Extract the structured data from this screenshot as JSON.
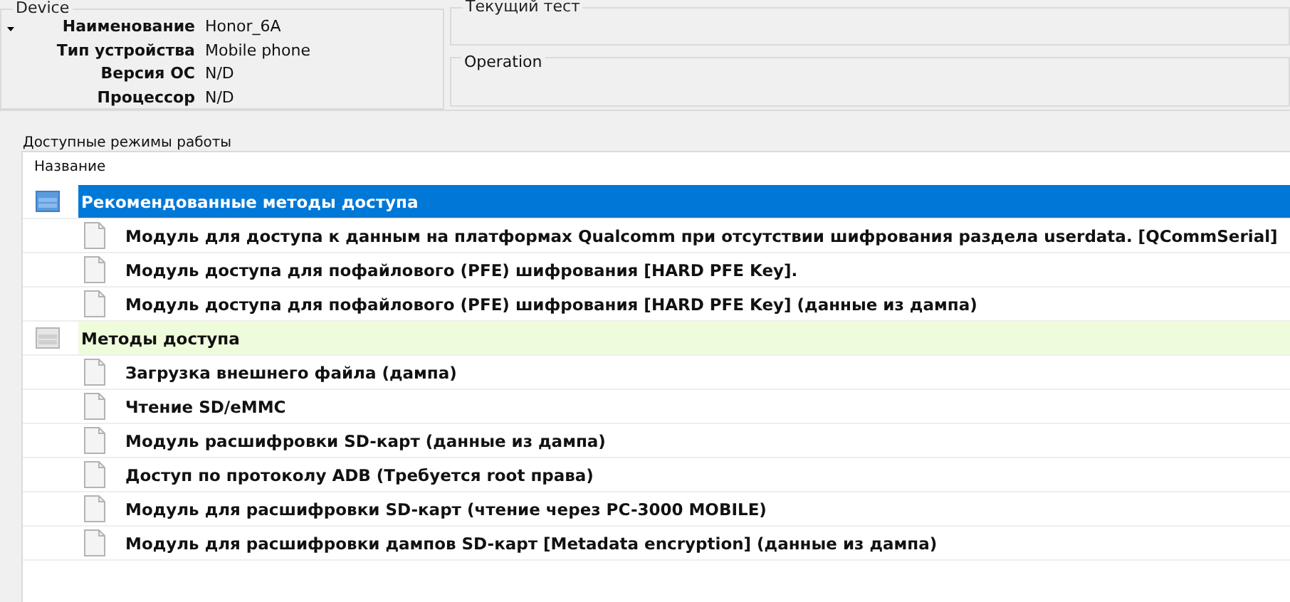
{
  "device": {
    "title": "Device",
    "fields": [
      {
        "label": "Наименование",
        "value": "Honor_6A"
      },
      {
        "label": "Тип устройства",
        "value": "Mobile phone"
      },
      {
        "label": "Версия ОС",
        "value": "N/D"
      },
      {
        "label": "Процессор",
        "value": "N/D"
      }
    ]
  },
  "current_test": {
    "title": "Текущий тест"
  },
  "operation": {
    "title": "Operation"
  },
  "modes": {
    "label": "Доступные режимы работы",
    "column": "Название",
    "groups": [
      {
        "title": "Рекомендованные методы доступа",
        "selected": true,
        "items": [
          "Модуль для доступа к данным на платформах Qualcomm при отсутствии шифрования раздела userdata. [QCommSerial]",
          "Модуль доступа для пофайлового (PFE) шифрования [HARD PFE Key].",
          "Модуль доступа для пофайлового (PFE) шифрования [HARD PFE Key] (данные из дампа)"
        ]
      },
      {
        "title": "Методы доступа",
        "selected": false,
        "items": [
          "Загрузка внешнего файла (дампа)",
          "Чтение SD/eMMC",
          "Модуль расшифровки SD-карт (данные из дампа)",
          "Доступ по протоколу ADB (Требуется root права)",
          "Модуль для расшифровки SD-карт (чтение через PC-3000 MOBILE)",
          "Модуль для расшифровки дампов SD-карт [Metadata encryption] (данные из дампа)"
        ]
      }
    ]
  }
}
